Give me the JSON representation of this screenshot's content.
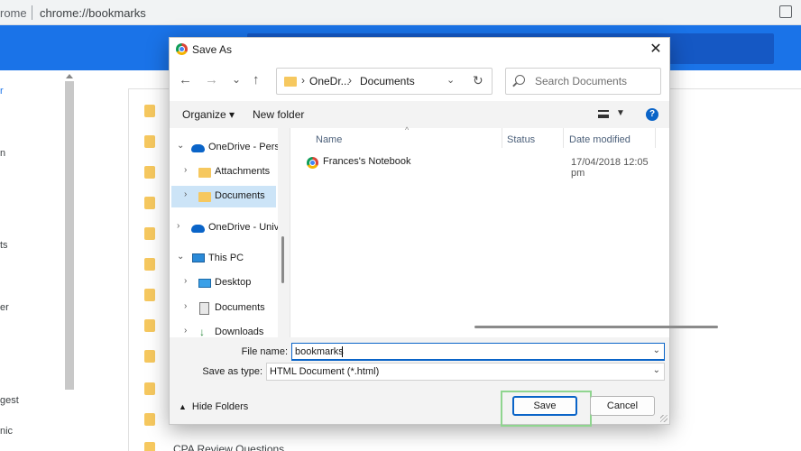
{
  "browser": {
    "app_text": "rome",
    "url": "chrome://bookmarks",
    "share_icon": "share-icon",
    "sidebar_fragments": [
      "r",
      "n",
      "ts",
      "er",
      "gest",
      "nic"
    ],
    "bottom_item": "CPA Review Questions"
  },
  "dialog": {
    "title": "Save As",
    "close_glyph": "✕",
    "nav": {
      "back": "←",
      "forward": "→",
      "recent": "⌄",
      "up": "↑"
    },
    "address": {
      "crumbs": [
        "OneDr...",
        "Documents"
      ],
      "separator": "›",
      "dropdown": "⌄",
      "refresh": "↻"
    },
    "search": {
      "placeholder": "Search Documents"
    },
    "commands": {
      "organize": "Organize ▾",
      "new_folder": "New folder",
      "view_dropdown": "▼",
      "help": "?"
    },
    "tree": [
      {
        "label": "OneDrive - Perso",
        "twisty": "⌄",
        "icon": "cloud"
      },
      {
        "label": "Attachments",
        "twisty": "›",
        "icon": "folder"
      },
      {
        "label": "Documents",
        "twisty": "›",
        "icon": "folder",
        "selected": true
      },
      {
        "label": "OneDrive - Unive",
        "twisty": "›",
        "icon": "cloud"
      },
      {
        "label": "This PC",
        "twisty": "⌄",
        "icon": "pc"
      },
      {
        "label": "Desktop",
        "twisty": "›",
        "icon": "desktop"
      },
      {
        "label": "Documents",
        "twisty": "›",
        "icon": "documents"
      },
      {
        "label": "Downloads",
        "twisty": "›",
        "icon": "downloads"
      }
    ],
    "columns": {
      "name": "Name",
      "status": "Status",
      "date_modified": "Date modified",
      "sort_caret": "^"
    },
    "files": [
      {
        "name": "Frances's Notebook",
        "date": "17/04/2018 12:05 pm"
      }
    ],
    "file_name_label": "File name:",
    "file_name_value": "bookmarks",
    "save_as_type_label": "Save as type:",
    "save_as_type_value": "HTML Document (*.html)",
    "field_dropdown": "⌄",
    "hide_folders": "Hide Folders",
    "hide_folders_caret": "▲",
    "save_label": "Save",
    "cancel_label": "Cancel"
  }
}
